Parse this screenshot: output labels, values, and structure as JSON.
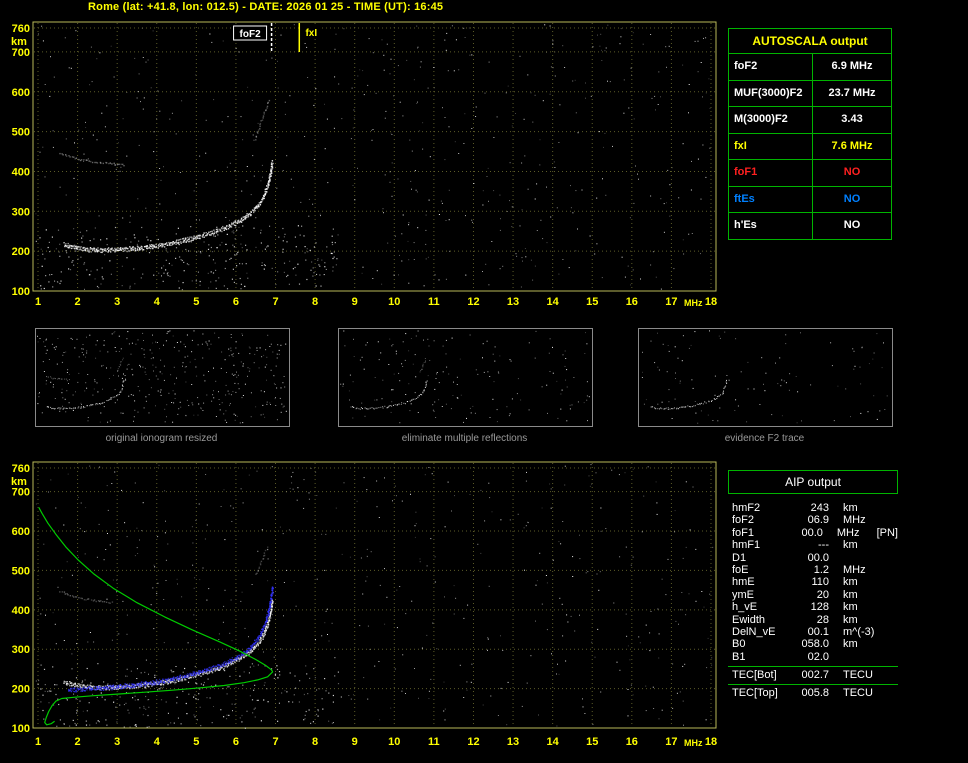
{
  "title": "Rome (lat: +41.8, lon: 012.5) - DATE: 2026 01 25 - TIME (UT): 16:45",
  "colors": {
    "background": "#000000",
    "axis_text": "#ffff00",
    "plot_border": "#b8b858",
    "grid": "#5c5c28",
    "trace_white": "#ffffff",
    "trace_blue": "#3333ff",
    "profile_green": "#00cc00",
    "table_border_green": "#00b400",
    "value_red": "#ff2020",
    "value_blue": "#0080ff",
    "value_yellow": "#ffff00",
    "caption_gray": "#9a9a9a"
  },
  "autoscala_table": {
    "header": "AUTOSCALA output",
    "rows": [
      {
        "label": "foF2",
        "value": "6.9 MHz",
        "color": "#ffffff"
      },
      {
        "label": "MUF(3000)F2",
        "value": "23.7 MHz",
        "color": "#ffffff"
      },
      {
        "label": "M(3000)F2",
        "value": "3.43",
        "color": "#ffffff"
      },
      {
        "label": "fxI",
        "value": "7.6 MHz",
        "color": "#ffff00"
      },
      {
        "label": "foF1",
        "value": "NO",
        "color": "#ff2020"
      },
      {
        "label": "ftEs",
        "value": "NO",
        "color": "#0080ff"
      },
      {
        "label": "h'Es",
        "value": "NO",
        "color": "#ffffff"
      }
    ]
  },
  "aip_table": {
    "header": "AIP output",
    "rows": [
      {
        "label": "hmF2",
        "value": "243",
        "unit": "km",
        "note": ""
      },
      {
        "label": "foF2",
        "value": "06.9",
        "unit": "MHz",
        "note": ""
      },
      {
        "label": "foF1",
        "value": "00.0",
        "unit": "MHz",
        "note": "[PN]"
      },
      {
        "label": "hmF1",
        "value": "---",
        "unit": "km",
        "note": ""
      },
      {
        "label": "D1",
        "value": "00.0",
        "unit": "",
        "note": ""
      },
      {
        "label": "foE",
        "value": "1.2",
        "unit": "MHz",
        "note": ""
      },
      {
        "label": "hmE",
        "value": "110",
        "unit": "km",
        "note": ""
      },
      {
        "label": "ymE",
        "value": "20",
        "unit": "km",
        "note": ""
      },
      {
        "label": "h_vE",
        "value": "128",
        "unit": "km",
        "note": ""
      },
      {
        "label": "Ewidth",
        "value": "28",
        "unit": "km",
        "note": ""
      },
      {
        "label": "DelN_vE",
        "value": "00.1",
        "unit": "m^(-3)",
        "note": ""
      },
      {
        "label": "B0",
        "value": "058.0",
        "unit": "km",
        "note": ""
      },
      {
        "label": "B1",
        "value": "02.0",
        "unit": "",
        "note": ""
      }
    ],
    "tec_rows": [
      {
        "label": "TEC[Bot]",
        "value": "002.7",
        "unit": "TECU",
        "note": ""
      },
      {
        "label": "TEC[Top]",
        "value": "005.8",
        "unit": "TECU",
        "note": ""
      }
    ]
  },
  "thumbnails": [
    {
      "caption": "original ionogram resized"
    },
    {
      "caption": "eliminate multiple reflections"
    },
    {
      "caption": "evidence F2 trace"
    }
  ],
  "chart_data": [
    {
      "id": "ionogram_top",
      "type": "scatter",
      "title": "recorded ionogram",
      "xlabel": "MHz",
      "ylabel": "km",
      "xlim": [
        1,
        18
      ],
      "ylim": [
        100,
        760
      ],
      "x_ticks": [
        1,
        2,
        3,
        4,
        5,
        6,
        7,
        8,
        9,
        10,
        11,
        12,
        13,
        14,
        15,
        16,
        17,
        18
      ],
      "y_ticks": [
        760,
        700,
        600,
        500,
        400,
        300,
        200,
        100
      ],
      "grid": true,
      "markers": [
        {
          "label": "foF2",
          "x": 6.9,
          "color": "#ffffff",
          "style": "dashed",
          "boxed": true
        },
        {
          "label": "fxI",
          "x": 7.6,
          "color": "#ffff00",
          "style": "solid",
          "boxed": false
        }
      ],
      "series": [
        {
          "name": "F2 trace echo",
          "style": "dots",
          "color": "#ffffff",
          "passes": 3,
          "opacity": 0.95,
          "points": [
            [
              1.65,
              218
            ],
            [
              1.9,
              211
            ],
            [
              2.2,
              206
            ],
            [
              2.6,
              204
            ],
            [
              3.0,
              205
            ],
            [
              3.4,
              208
            ],
            [
              3.8,
              212
            ],
            [
              4.2,
              218
            ],
            [
              4.6,
              226
            ],
            [
              5.0,
              236
            ],
            [
              5.4,
              248
            ],
            [
              5.8,
              263
            ],
            [
              6.1,
              278
            ],
            [
              6.35,
              295
            ],
            [
              6.55,
              315
            ],
            [
              6.7,
              340
            ],
            [
              6.8,
              368
            ],
            [
              6.87,
              398
            ],
            [
              6.91,
              428
            ]
          ]
        },
        {
          "name": "second hop echo",
          "style": "dots",
          "color": "#c8c8c8",
          "passes": 1,
          "opacity": 0.6,
          "points": [
            [
              1.55,
              448
            ],
            [
              1.8,
              438
            ],
            [
              2.1,
              430
            ],
            [
              2.5,
              424
            ],
            [
              2.9,
              420
            ],
            [
              3.2,
              418
            ]
          ]
        },
        {
          "name": "oblique echo",
          "style": "dots",
          "color": "#b8b8b8",
          "passes": 1,
          "opacity": 0.55,
          "points": [
            [
              6.45,
              478
            ],
            [
              6.55,
              505
            ],
            [
              6.65,
              532
            ],
            [
              6.75,
              558
            ],
            [
              6.85,
              585
            ]
          ]
        }
      ]
    },
    {
      "id": "ionogram_bottom",
      "type": "scatter",
      "title": "autoscaled ionogram with restored trace and electron density profile",
      "xlabel": "MHz",
      "ylabel": "km",
      "xlim": [
        1,
        18
      ],
      "ylim": [
        100,
        760
      ],
      "x_ticks": [
        1,
        2,
        3,
        4,
        5,
        6,
        7,
        8,
        9,
        10,
        11,
        12,
        13,
        14,
        15,
        16,
        17,
        18
      ],
      "y_ticks": [
        760,
        700,
        600,
        500,
        400,
        300,
        200,
        100
      ],
      "grid": true,
      "markers": [],
      "series": [
        {
          "name": "F2 trace echo",
          "style": "dots",
          "color": "#ffffff",
          "passes": 3,
          "opacity": 0.9,
          "points": [
            [
              1.65,
              218
            ],
            [
              1.9,
              211
            ],
            [
              2.2,
              206
            ],
            [
              2.6,
              204
            ],
            [
              3.0,
              205
            ],
            [
              3.4,
              208
            ],
            [
              3.8,
              212
            ],
            [
              4.2,
              218
            ],
            [
              4.6,
              226
            ],
            [
              5.0,
              236
            ],
            [
              5.4,
              248
            ],
            [
              5.8,
              263
            ],
            [
              6.1,
              278
            ],
            [
              6.35,
              295
            ],
            [
              6.55,
              315
            ],
            [
              6.7,
              340
            ],
            [
              6.8,
              368
            ],
            [
              6.87,
              398
            ],
            [
              6.91,
              428
            ]
          ]
        },
        {
          "name": "second hop echo",
          "style": "dots",
          "color": "#c0c0c0",
          "passes": 1,
          "opacity": 0.5,
          "points": [
            [
              1.55,
              448
            ],
            [
              1.8,
              438
            ],
            [
              2.1,
              430
            ],
            [
              2.5,
              424
            ],
            [
              2.9,
              420
            ]
          ]
        },
        {
          "name": "oblique echo",
          "style": "dots",
          "color": "#b0b0b0",
          "passes": 1,
          "opacity": 0.45,
          "points": [
            [
              6.5,
              490
            ],
            [
              6.6,
              515
            ],
            [
              6.7,
              542
            ],
            [
              6.8,
              565
            ]
          ]
        },
        {
          "name": "restored F2 trace",
          "style": "dots",
          "color": "#3333ff",
          "passes": 3,
          "opacity": 0.95,
          "points": [
            [
              1.75,
              198
            ],
            [
              2.1,
              200
            ],
            [
              2.5,
              202
            ],
            [
              2.9,
              205
            ],
            [
              3.3,
              209
            ],
            [
              3.7,
              214
            ],
            [
              4.1,
              220
            ],
            [
              4.5,
              228
            ],
            [
              4.9,
              238
            ],
            [
              5.3,
              250
            ],
            [
              5.7,
              264
            ],
            [
              6.0,
              279
            ],
            [
              6.25,
              295
            ],
            [
              6.45,
              315
            ],
            [
              6.6,
              338
            ],
            [
              6.72,
              365
            ],
            [
              6.82,
              398
            ],
            [
              6.88,
              432
            ],
            [
              6.91,
              462
            ]
          ]
        },
        {
          "name": "profile topside",
          "style": "line",
          "color": "#00cc00",
          "points": [
            [
              1.02,
              660
            ],
            [
              1.1,
              645
            ],
            [
              1.25,
              620
            ],
            [
              1.45,
              592
            ],
            [
              1.7,
              560
            ],
            [
              2.0,
              528
            ],
            [
              2.4,
              492
            ],
            [
              2.9,
              455
            ],
            [
              3.5,
              418
            ],
            [
              4.2,
              382
            ],
            [
              4.9,
              349
            ],
            [
              5.6,
              318
            ],
            [
              6.1,
              295
            ],
            [
              6.5,
              274
            ],
            [
              6.75,
              259
            ],
            [
              6.88,
              249
            ],
            [
              6.93,
              243
            ]
          ]
        },
        {
          "name": "profile bottomside and E layer",
          "style": "line",
          "color": "#00cc00",
          "points": [
            [
              6.93,
              243
            ],
            [
              6.8,
              230
            ],
            [
              6.55,
              222
            ],
            [
              6.2,
              215
            ],
            [
              5.7,
              208
            ],
            [
              5.1,
              202
            ],
            [
              4.4,
              196
            ],
            [
              3.7,
              191
            ],
            [
              3.0,
              186
            ],
            [
              2.4,
              182
            ],
            [
              1.9,
              178
            ],
            [
              1.6,
              175
            ],
            [
              1.45,
              168
            ],
            [
              1.35,
              156
            ],
            [
              1.27,
              142
            ],
            [
              1.21,
              127
            ],
            [
              1.17,
              114
            ],
            [
              1.22,
              108
            ],
            [
              1.33,
              111
            ],
            [
              1.42,
              117
            ]
          ]
        }
      ]
    }
  ]
}
